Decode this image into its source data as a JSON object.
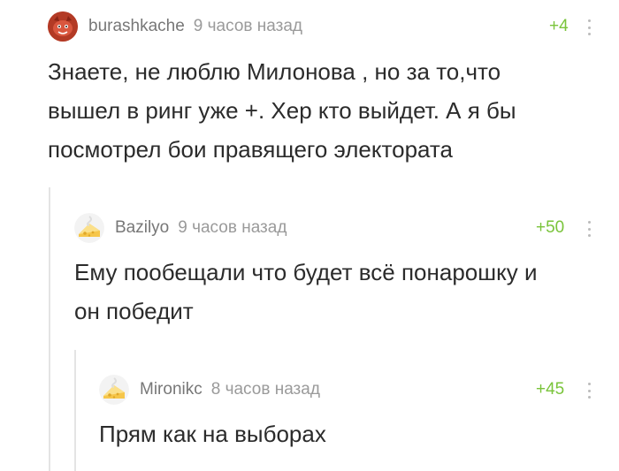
{
  "comments": [
    {
      "username": "burashkache",
      "time": "9 часов назад",
      "rating": "+4",
      "avatar_icon": "red-dog-avatar-icon",
      "text_lines": [
        "Знаете, не люблю Милонова , но за то,что",
        "вышел в ринг уже +. Хер кто выйдет. А я бы",
        "посмотрел бои правящего электората"
      ]
    },
    {
      "username": "Bazilyo",
      "time": "9 часов назад",
      "rating": "+50",
      "avatar_icon": "default-cheese-avatar-icon",
      "text_lines": [
        "Ему пообещали что будет всё понарошку и",
        "он победит"
      ]
    },
    {
      "username": "Mironikc",
      "time": "8 часов назад",
      "rating": "+45",
      "avatar_icon": "default-cheese-avatar-icon",
      "text_lines": [
        "Прям как на выборах"
      ]
    }
  ],
  "colors": {
    "rating": "#7ac43b",
    "username": "#777777",
    "time": "#9a9a9a",
    "thread_line": "#e4e4e4"
  }
}
